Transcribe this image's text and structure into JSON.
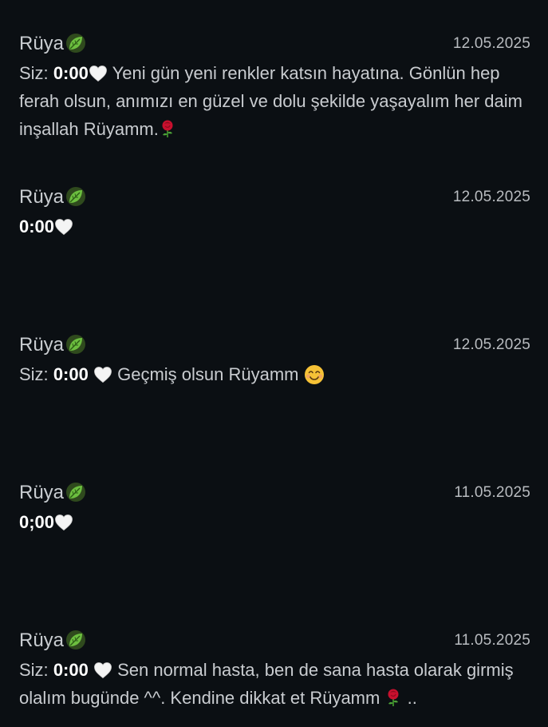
{
  "chats": [
    {
      "name": "Rüya",
      "date": "12.05.2025",
      "prefix": "Siz:",
      "time": "0:00",
      "text": "Yeni gün yeni renkler katsın hayatına. Gönlün hep ferah olsun, anımızı en güzel ve dolu şekilde yaşayalım her daim inşallah Rüyamm.",
      "trailing": ""
    },
    {
      "name": "Rüya",
      "date": "12.05.2025",
      "time": "0:00"
    },
    {
      "name": "Rüya",
      "date": "12.05.2025",
      "prefix": "Siz:",
      "time": "0:00",
      "text": "Geçmiş olsun Rüyamm"
    },
    {
      "name": "Rüya",
      "date": "11.05.2025",
      "time": "0;00"
    },
    {
      "name": "Rüya",
      "date": "11.05.2025",
      "prefix": "Siz:",
      "time": "0:00",
      "text": "Sen normal hasta, ben de sana hasta olarak girmiş olalım bugünde ^^. Kendine dikkat et Rüyamm",
      "trailing": ".."
    }
  ],
  "icons": {
    "name_suffix": "leaf-icon",
    "heart": "white-heart-icon",
    "rose": "rose-icon",
    "smile": "smiling-face-icon"
  },
  "colors": {
    "background": "#0b0f13",
    "text": "#c9ccd0",
    "time": "#ffffff",
    "leaf": "#5fae3a",
    "rose": "#c8102e"
  }
}
